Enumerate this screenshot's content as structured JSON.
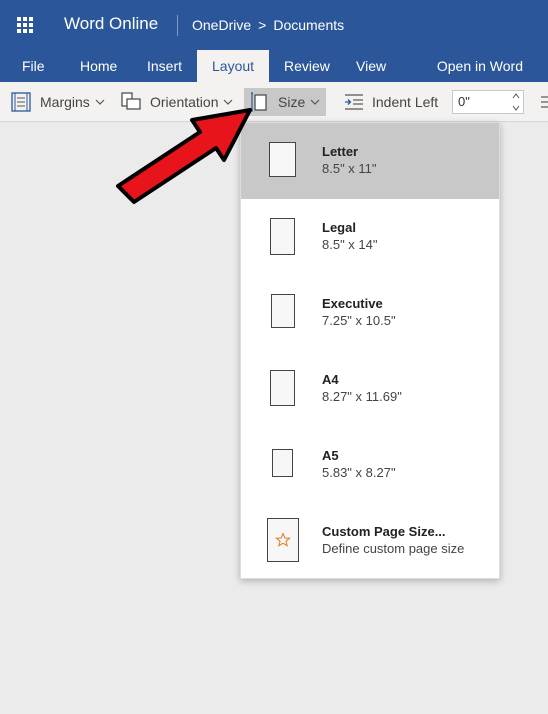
{
  "titlebar": {
    "app_name": "Word Online",
    "breadcrumb_root": "OneDrive",
    "breadcrumb_separator": ">",
    "breadcrumb_current": "Documents"
  },
  "tabs": {
    "file": "File",
    "home": "Home",
    "insert": "Insert",
    "layout": "Layout",
    "review": "Review",
    "view": "View",
    "open_in_word": "Open in Word"
  },
  "ribbon": {
    "margins": "Margins",
    "orientation": "Orientation",
    "size": "Size",
    "indent_left": "Indent Left",
    "indent_value": "0\""
  },
  "size_menu": {
    "letter_name": "Letter",
    "letter_dims": "8.5\" x 11\"",
    "legal_name": "Legal",
    "legal_dims": "8.5\" x 14\"",
    "executive_name": "Executive",
    "executive_dims": "7.25\" x 10.5\"",
    "a4_name": "A4",
    "a4_dims": "8.27\" x 11.69\"",
    "a5_name": "A5",
    "a5_dims": "5.83\" x 8.27\"",
    "custom_name": "Custom Page Size...",
    "custom_desc": "Define custom page size"
  },
  "colors": {
    "brand_blue": "#2b579a",
    "selected_item": "#c8c8c8",
    "annotation_arrow": "#e8141c"
  }
}
